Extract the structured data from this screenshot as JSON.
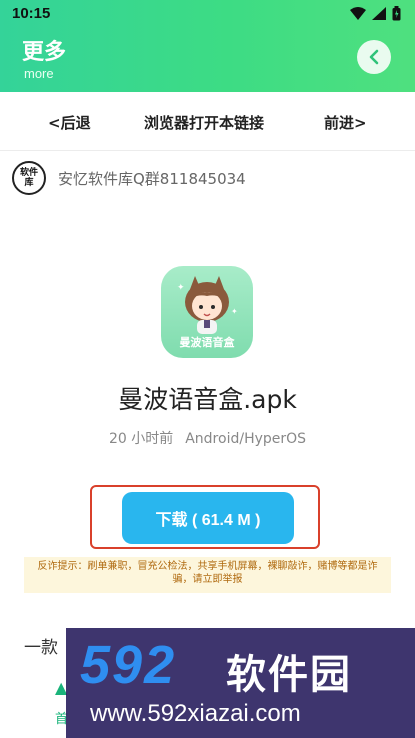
{
  "status_bar": {
    "time": "10:15"
  },
  "header": {
    "title": "更多",
    "subtitle": "more"
  },
  "nav": {
    "back": "<后退",
    "open_in_browser": "浏览器打开本链接",
    "forward": "前进>"
  },
  "group": {
    "avatar_text": "软件\n库",
    "text": "安忆软件库Q群811845034"
  },
  "app": {
    "icon_label": "曼波语音盒",
    "file_name": "曼波语音盒.apk",
    "time_ago": "20 小时前",
    "platform": "Android/HyperOS"
  },
  "download": {
    "label": "下载 ( 61.4 M )"
  },
  "warning": {
    "text": "反诈提示：刷单兼职，冒充公检法，共享手机屏幕，裸聊敲诈，赌博等都是诈骗，请立即举报"
  },
  "description": {
    "text": "一款"
  },
  "bottom_tab": {
    "label": "首"
  },
  "watermark": {
    "logo": "592",
    "brand": "软件园",
    "url": "www.592xiazai.com"
  },
  "colors": {
    "header_green": "#3ddc84",
    "download_blue": "#29b6ee",
    "highlight_red": "#d9402b"
  }
}
